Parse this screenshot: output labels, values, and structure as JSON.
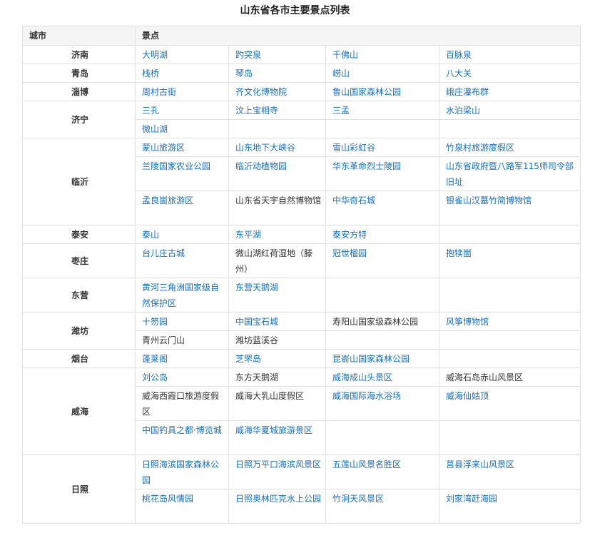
{
  "title": "山东省各市主要景点列表",
  "headers": {
    "city": "城市",
    "spots": "景点"
  },
  "colors": {
    "link": "#136ec2",
    "text": "#333333",
    "border": "#e0e0e0",
    "header_bg": "#f5f5f5"
  },
  "rows": [
    {
      "city": "济南",
      "lines": [
        [
          {
            "text": "大明湖",
            "link": true
          },
          {
            "text": "趵突泉",
            "link": true
          },
          {
            "text": "千佛山",
            "link": true
          },
          {
            "text": "百脉泉",
            "link": true
          }
        ]
      ]
    },
    {
      "city": "青岛",
      "lines": [
        [
          {
            "text": "栈桥",
            "link": true
          },
          {
            "text": "琴岛",
            "link": true
          },
          {
            "text": "崂山",
            "link": true
          },
          {
            "text": "八大关",
            "link": true
          }
        ]
      ]
    },
    {
      "city": "淄博",
      "lines": [
        [
          {
            "text": "周村古街",
            "link": true
          },
          {
            "text": "齐文化博物院",
            "link": true
          },
          {
            "text": "鲁山国家森林公园",
            "link": true
          },
          {
            "text": "峨庄瀑布群",
            "link": true
          }
        ]
      ]
    },
    {
      "city": "济宁",
      "lines": [
        [
          {
            "text": "三孔",
            "link": true
          },
          {
            "text": "汶上宝相寺",
            "link": true
          },
          {
            "text": "三孟",
            "link": true
          },
          {
            "text": "水泊梁山",
            "link": true
          }
        ],
        [
          {
            "text": "微山湖",
            "link": true
          },
          {
            "text": "",
            "link": false
          },
          {
            "text": "",
            "link": false
          },
          {
            "text": "",
            "link": false
          }
        ]
      ]
    },
    {
      "city": "临沂",
      "lines": [
        [
          {
            "text": "蒙山旅游区",
            "link": true
          },
          {
            "text": "山东地下大峡谷",
            "link": true
          },
          {
            "text": "雪山彩虹谷",
            "link": true
          },
          {
            "text": "竹泉村旅游度假区",
            "link": true
          }
        ],
        [
          {
            "text": "兰陵国家农业公园",
            "link": true
          },
          {
            "text": "临沂动植物园",
            "link": true
          },
          {
            "text": "华东革命烈士陵园",
            "link": true
          },
          {
            "text": "山东省政府暨八路军115师司令部旧址",
            "link": true
          }
        ],
        [
          {
            "text": "孟良崮旅游区",
            "link": true
          },
          {
            "text": "山东省天宇自然博物馆",
            "link": false
          },
          {
            "text": "中华奇石城",
            "link": true
          },
          {
            "text": "银雀山汉墓竹简博物馆",
            "link": true
          }
        ]
      ]
    },
    {
      "city": "泰安",
      "lines": [
        [
          {
            "text": "泰山",
            "link": true
          },
          {
            "text": "东平湖",
            "link": true
          },
          {
            "text": "泰安方特",
            "link": true
          },
          {
            "text": "",
            "link": false
          }
        ]
      ]
    },
    {
      "city": "枣庄",
      "lines": [
        [
          {
            "text": "台儿庄古城",
            "link": true
          },
          {
            "text": "微山湖红荷湿地（滕州）",
            "link": false
          },
          {
            "text": "冠世榴园",
            "link": true
          },
          {
            "text": "抱犊崮",
            "link": true
          }
        ]
      ]
    },
    {
      "city": "东营",
      "lines": [
        [
          {
            "text": "黄河三角洲国家级自然保护区",
            "link": true
          },
          {
            "text": "东营天鹅湖",
            "link": true
          },
          {
            "text": "",
            "link": false
          },
          {
            "text": "",
            "link": false
          }
        ]
      ]
    },
    {
      "city": "潍坊",
      "lines": [
        [
          {
            "text": "十笏园",
            "link": true
          },
          {
            "text": "中国宝石城",
            "link": true
          },
          {
            "text": "寿阳山国家级森林公园",
            "link": false
          },
          {
            "text": "风筝博物馆",
            "link": true
          }
        ],
        [
          {
            "text": "青州云门山",
            "link": false
          },
          {
            "text": "潍坊蓝溪谷",
            "link": false
          },
          {
            "text": "",
            "link": false
          },
          {
            "text": "",
            "link": false
          }
        ]
      ]
    },
    {
      "city": "烟台",
      "lines": [
        [
          {
            "text": "蓬莱阁",
            "link": true
          },
          {
            "text": "芝罘岛",
            "link": true
          },
          {
            "text": "昆嵛山国家森林公园",
            "link": true
          },
          {
            "text": "",
            "link": false
          }
        ]
      ]
    },
    {
      "city": "威海",
      "lines": [
        [
          {
            "text": "刘公岛",
            "link": true
          },
          {
            "text": "东方天鹅湖",
            "link": false
          },
          {
            "text": "威海成山头景区",
            "link": true
          },
          {
            "text": "威海石岛赤山风景区",
            "link": false
          }
        ],
        [
          {
            "text": "威海西霞口旅游度假区",
            "link": false
          },
          {
            "text": "威海大乳山度假区",
            "link": false
          },
          {
            "text": "威海国际海水浴场",
            "link": true
          },
          {
            "text": "威海仙姑顶",
            "link": true
          }
        ],
        [
          {
            "text": "中国钓具之都·博览城",
            "link": true
          },
          {
            "text": "威海华夏城旅游景区",
            "link": true
          },
          {
            "text": "",
            "link": false
          },
          {
            "text": "",
            "link": false
          }
        ]
      ]
    },
    {
      "city": "日照",
      "lines": [
        [
          {
            "text": "日照海滨国家森林公园",
            "link": true
          },
          {
            "text": "日照万平口海滨风景区",
            "link": true
          },
          {
            "text": "五莲山风景名胜区",
            "link": true
          },
          {
            "text": "莒县浮来山风景区",
            "link": true
          }
        ],
        [
          {
            "text": "桃花岛风情园",
            "link": true
          },
          {
            "text": "日照奥林匹克水上公园",
            "link": true
          },
          {
            "text": "竹洞天风景区",
            "link": true
          },
          {
            "text": "刘家湾赶海园",
            "link": true
          }
        ]
      ]
    }
  ]
}
